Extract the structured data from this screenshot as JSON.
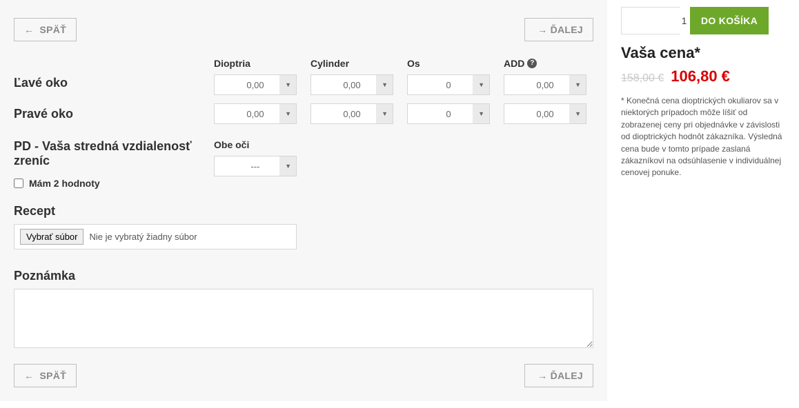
{
  "nav": {
    "back": "SPÄŤ",
    "next": "ĎALEJ"
  },
  "rows": {
    "left_eye": "Ľavé oko",
    "right_eye": "Pravé oko",
    "pd": "PD - Vaša stredná vzdialenosť zreníc"
  },
  "columns": {
    "dioptria": "Dioptria",
    "cylinder": "Cylinder",
    "os": "Os",
    "add": "ADD"
  },
  "values": {
    "left": {
      "dioptria": "0,00",
      "cylinder": "0,00",
      "os": "0",
      "add": "0,00"
    },
    "right": {
      "dioptria": "0,00",
      "cylinder": "0,00",
      "os": "0",
      "add": "0,00"
    },
    "pd_label": "Obe oči",
    "pd_value": "---"
  },
  "two_values_label": "Mám 2 hodnoty",
  "recipe": {
    "title": "Recept",
    "choose": "Vybrať súbor",
    "nofile": "Nie je vybratý žiadny súbor"
  },
  "note": {
    "title": "Poznámka"
  },
  "cart": {
    "qty": "1",
    "button": "DO KOŠÍKA",
    "price_title": "Vaša cena*",
    "old_price": "158,00 €",
    "new_price": "106,80 €",
    "disclaimer": "* Konečná cena dioptrických okuliarov sa v niektorých prípadoch môže líšiť od zobrazenej ceny pri objednávke v závislosti od dioptrických hodnôt zákazníka. Výsledná cena bude v tomto prípade zaslaná zákazníkovi na odsúhlasenie v individuálnej cenovej ponuke."
  }
}
